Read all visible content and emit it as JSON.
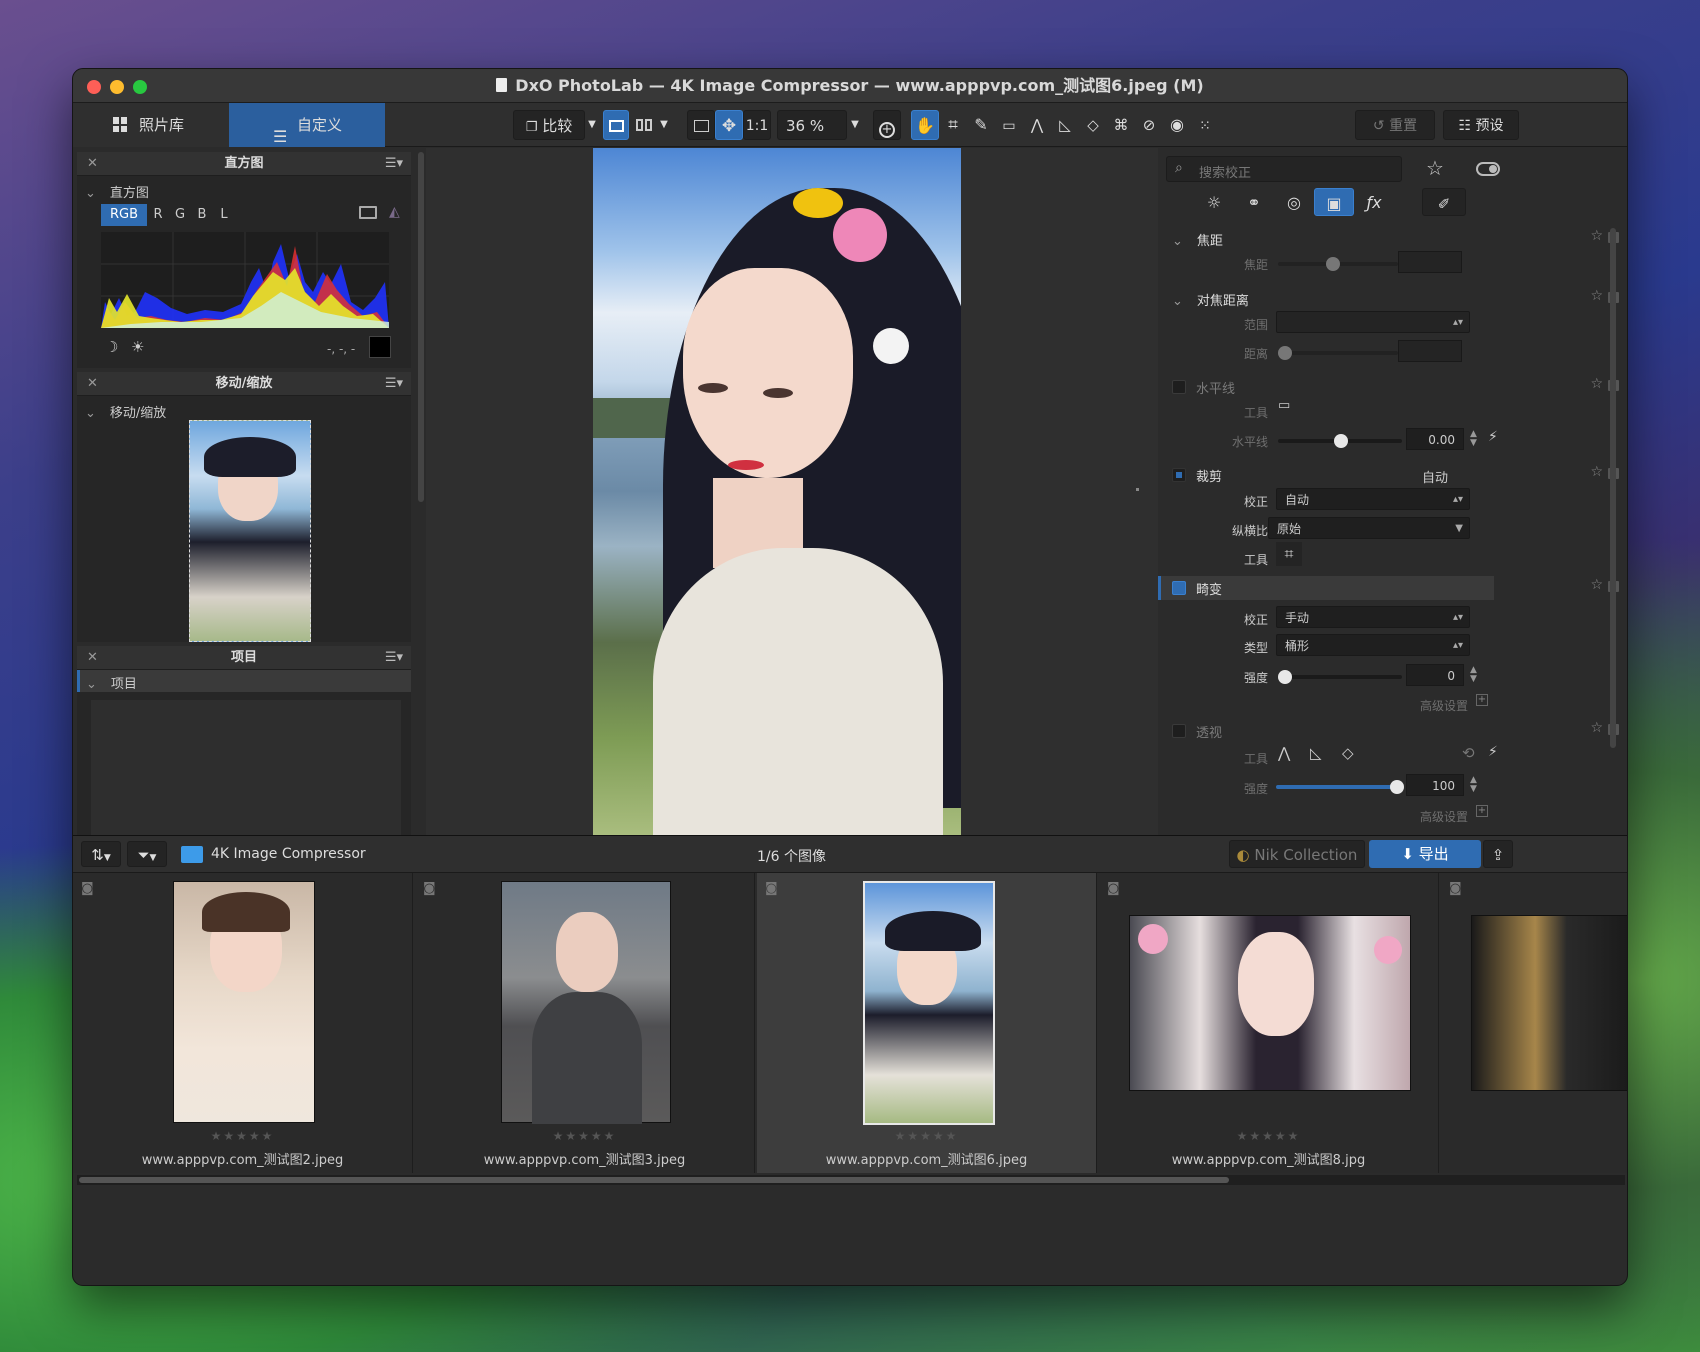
{
  "window": {
    "title": "DxO PhotoLab — 4K Image Compressor — www.apppvp.com_测试图6.jpeg (M)"
  },
  "toolbar": {
    "tab_library": "照片库",
    "tab_customize": "自定义",
    "compare": "比较",
    "zoom_1to1": "1:1",
    "zoom_level": "36 %",
    "reset": "重置",
    "presets": "预设"
  },
  "left": {
    "histogram": {
      "header": "直方图",
      "section": "直方图",
      "channels": [
        "RGB",
        "R",
        "G",
        "B",
        "L"
      ],
      "readout": "-, -, -"
    },
    "navigator": {
      "header": "移动/缩放",
      "section": "移动/缩放"
    },
    "project": {
      "header": "项目",
      "section": "项目"
    }
  },
  "right": {
    "search_placeholder": "搜索校正",
    "focal": {
      "title": "焦距",
      "row_focal": "焦距"
    },
    "focus_distance": {
      "title": "对焦距离",
      "row_range": "范围",
      "row_distance": "距离"
    },
    "horizon": {
      "title": "水平线",
      "row_tool": "工具",
      "row_horizon": "水平线",
      "value": "0.00"
    },
    "crop": {
      "title": "裁剪",
      "mode": "自动",
      "row_correction": "校正",
      "correction_value": "自动",
      "row_ratio": "纵横比",
      "ratio_value": "原始",
      "row_tool": "工具"
    },
    "distortion": {
      "title": "畸变",
      "row_correction": "校正",
      "correction_value": "手动",
      "row_type": "类型",
      "type_value": "桶形",
      "row_strength": "强度",
      "strength_value": "0",
      "advanced": "高级设置"
    },
    "perspective": {
      "title": "透视",
      "row_tool": "工具",
      "row_strength": "强度",
      "strength_value": "100",
      "advanced": "高级设置"
    }
  },
  "filmstrip": {
    "folder": "4K Image Compressor",
    "count": "1/6 个图像",
    "nik": "Nik Collection",
    "export": "导出",
    "items": [
      {
        "name": "www.apppvp.com_测试图2.jpeg",
        "rating": 0
      },
      {
        "name": "www.apppvp.com_测试图3.jpeg",
        "rating": 0
      },
      {
        "name": "www.apppvp.com_测试图6.jpeg",
        "rating": 0
      },
      {
        "name": "www.apppvp.com_测试图8.jpg",
        "rating": 0
      }
    ]
  },
  "colors": {
    "accent": "#2f6cb2"
  }
}
